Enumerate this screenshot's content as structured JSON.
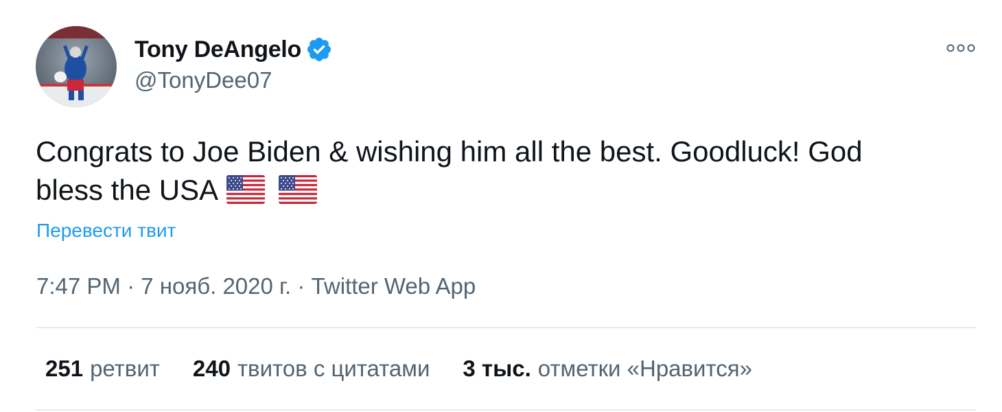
{
  "author": {
    "display_name": "Tony DeAngelo",
    "handle": "@TonyDee07",
    "verified": true
  },
  "tweet": {
    "text_line1": "Congrats to Joe Biden & wishing him all the best. Goodluck! God",
    "text_line2": "bless the USA",
    "emoji": [
      "flag-usa-icon",
      "flag-usa-icon"
    ]
  },
  "translate_link": "Перевести твит",
  "meta": {
    "time": "7:47 PM",
    "separator": " · ",
    "date": "7 нояб. 2020 г.",
    "source": "Twitter Web App"
  },
  "stats": [
    {
      "count": "251",
      "label": "ретвит"
    },
    {
      "count": "240",
      "label": "твитов с цитатами"
    },
    {
      "count": "3 тыс.",
      "label": "отметки «Нравится»"
    }
  ],
  "colors": {
    "accent": "#1d9bf0",
    "text": "#0f1419",
    "muted": "#536471",
    "divider": "#e6ecf0"
  }
}
